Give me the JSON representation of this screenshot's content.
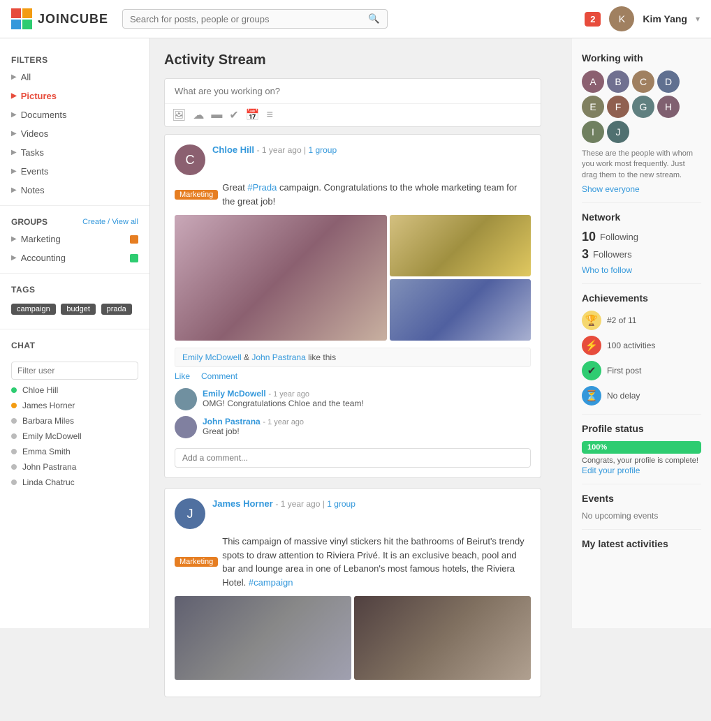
{
  "header": {
    "logo_text": "JOINCUBE",
    "search_placeholder": "Search for posts, people or groups",
    "notifications_count": "2",
    "user_name": "Kim Yang"
  },
  "sidebar": {
    "filters_title": "Filters",
    "filter_items": [
      {
        "label": "All",
        "active": false
      },
      {
        "label": "Pictures",
        "active": true
      },
      {
        "label": "Documents",
        "active": false
      },
      {
        "label": "Videos",
        "active": false
      },
      {
        "label": "Tasks",
        "active": false
      },
      {
        "label": "Events",
        "active": false
      },
      {
        "label": "Notes",
        "active": false
      }
    ],
    "groups_title": "Groups",
    "groups_link": "Create / View all",
    "groups": [
      {
        "label": "Marketing",
        "color": "#e67e22"
      },
      {
        "label": "Accounting",
        "color": "#2ecc71"
      }
    ],
    "tags_title": "Tags",
    "tags": [
      "campaign",
      "budget",
      "prada"
    ],
    "chat_title": "Chat",
    "chat_filter_placeholder": "Filter user",
    "chat_users": [
      {
        "name": "Chloe Hill",
        "status": "online",
        "color": "#2ecc71"
      },
      {
        "name": "James Horner",
        "status": "away",
        "color": "#f39c12"
      },
      {
        "name": "Barbara Miles",
        "status": "offline",
        "color": "#bbb"
      },
      {
        "name": "Emily McDowell",
        "status": "offline",
        "color": "#bbb"
      },
      {
        "name": "Emma Smith",
        "status": "offline",
        "color": "#bbb"
      },
      {
        "name": "John Pastrana",
        "status": "offline",
        "color": "#bbb"
      },
      {
        "name": "Linda Chatruc",
        "status": "offline",
        "color": "#bbb"
      }
    ]
  },
  "main": {
    "page_title": "Activity Stream",
    "post_input_placeholder": "What are you working on?",
    "posts": [
      {
        "id": "post1",
        "author": "Chloe Hill",
        "time": "1 year ago",
        "group": "1 group",
        "badge": "Marketing",
        "text": "Great #Prada campaign. Congratulations to the whole marketing team for the great job!",
        "likes": "Emily McDowell & John Pastrana like this",
        "like_label": "Like",
        "comment_label": "Comment",
        "comments": [
          {
            "author": "Emily McDowell",
            "time": "1 year ago",
            "text": "OMG! Congratulations Chloe and the team!"
          },
          {
            "author": "John Pastrana",
            "time": "1 year ago",
            "text": "Great job!"
          }
        ],
        "comment_placeholder": "Add a comment..."
      },
      {
        "id": "post2",
        "author": "James Horner",
        "time": "1 year ago",
        "group": "1 group",
        "badge": "Marketing",
        "text": "This campaign of massive vinyl stickers hit the bathrooms of Beirut's trendy spots to draw attention to Riviera Privé. It is an exclusive beach, pool and bar and lounge area in one of Lebanon's most famous hotels, the Riviera Hotel. #campaign"
      }
    ]
  },
  "right_panel": {
    "working_with_title": "Working with",
    "working_with_desc": "These are the people with whom you work most frequently. Just drag them to the new stream.",
    "show_everyone_label": "Show everyone",
    "network_title": "Network",
    "following_count": "10",
    "following_label": "Following",
    "followers_count": "3",
    "followers_label": "Followers",
    "who_to_follow_label": "Who to follow",
    "achievements_title": "Achievements",
    "achievements": [
      {
        "icon": "🏆",
        "text": "#2 of 11",
        "bg": "#f5d76e"
      },
      {
        "icon": "⚡",
        "text": "100 activities",
        "bg": "#e74c3c"
      },
      {
        "icon": "✔",
        "text": "First post",
        "bg": "#2ecc71"
      },
      {
        "icon": "⏳",
        "text": "No delay",
        "bg": "#3498db"
      }
    ],
    "profile_status_title": "Profile status",
    "profile_progress": "100%",
    "profile_congrats": "Congrats, your profile is complete!",
    "edit_profile_label": "Edit your profile",
    "events_title": "Events",
    "events_none": "No upcoming events",
    "latest_activities_title": "My latest activities"
  }
}
